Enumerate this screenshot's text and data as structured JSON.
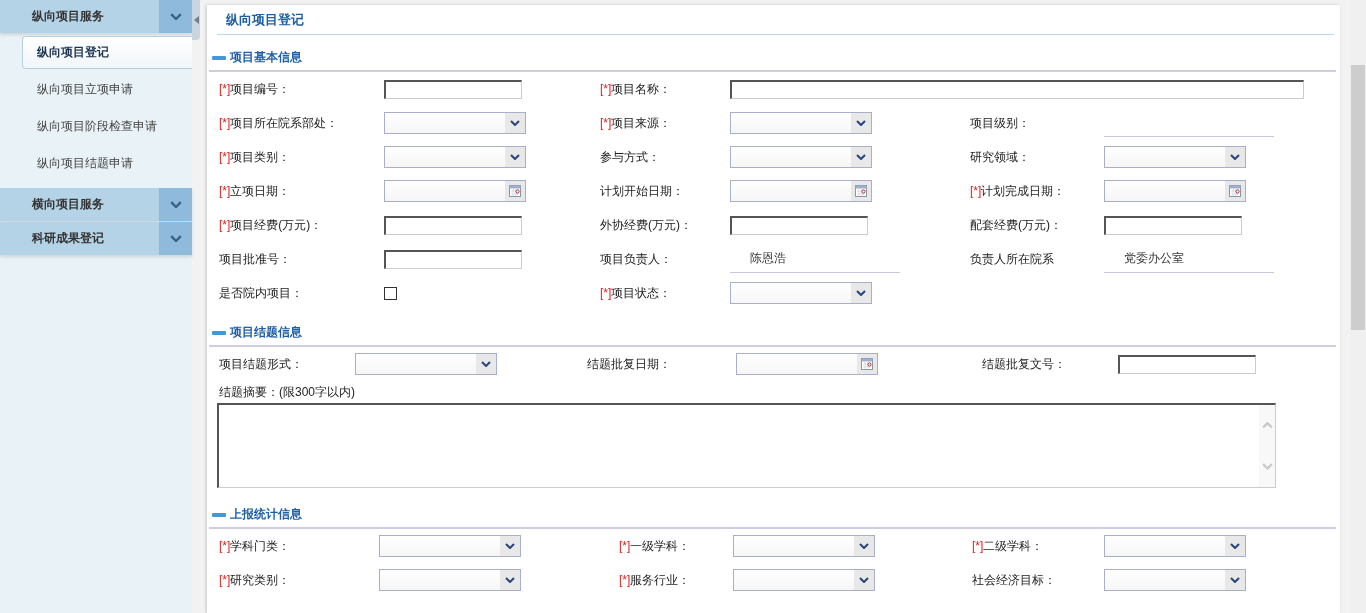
{
  "sidebar": {
    "groups": [
      {
        "label": "纵向项目服务",
        "items": [
          {
            "label": "纵向项目登记",
            "selected": true
          },
          {
            "label": "纵向项目立项申请",
            "selected": false
          },
          {
            "label": "纵向项目阶段检查申请",
            "selected": false
          },
          {
            "label": "纵向项目结题申请",
            "selected": false
          }
        ]
      },
      {
        "label": "横向项目服务"
      },
      {
        "label": "科研成果登记"
      }
    ]
  },
  "panel": {
    "title": "纵向项目登记"
  },
  "sections": [
    {
      "title": "项目基本信息",
      "rows": [
        [
          {
            "required_mark": "[*]",
            "label": "项目编号：",
            "kind": "text"
          },
          {
            "required_mark": "[*]",
            "label": "项目名称：",
            "kind": "wide_text"
          }
        ],
        [
          {
            "required_mark": "[*]",
            "label": "项目所在院系部处：",
            "kind": "select"
          },
          {
            "required_mark": "[*]",
            "label": "项目来源：",
            "kind": "select"
          },
          {
            "label": "项目级别：",
            "kind": "readonly"
          }
        ],
        [
          {
            "required_mark": "[*]",
            "label": "项目类别：",
            "kind": "select"
          },
          {
            "label": "参与方式：",
            "kind": "select"
          },
          {
            "label": "研究领域：",
            "kind": "select"
          }
        ],
        [
          {
            "required_mark": "[*]",
            "label": "立项日期：",
            "kind": "date"
          },
          {
            "label": "计划开始日期：",
            "kind": "date"
          },
          {
            "required_mark": "[*]",
            "label": "计划完成日期：",
            "kind": "date"
          }
        ],
        [
          {
            "required_mark": "[*]",
            "label": "项目经费(万元)：",
            "kind": "text"
          },
          {
            "label": "外协经费(万元)：",
            "kind": "text"
          },
          {
            "label": "配套经费(万元)：",
            "kind": "text"
          }
        ],
        [
          {
            "label": "项目批准号：",
            "kind": "text"
          },
          {
            "label": "项目负责人：",
            "kind": "readonly",
            "value": "陈恩浩"
          },
          {
            "label": "负责人所在院系",
            "kind": "readonly",
            "value": "党委办公室"
          }
        ],
        [
          {
            "label": "是否院内项目：",
            "kind": "checkbox",
            "checked": false
          },
          {
            "required_mark": "[*]",
            "label": "项目状态：",
            "kind": "select"
          }
        ]
      ]
    },
    {
      "title": "项目结题信息",
      "rows": [
        [
          {
            "label": "项目结题形式：",
            "kind": "select"
          },
          {
            "label": "结题批复日期：",
            "kind": "date"
          },
          {
            "label": "结题批复文号：",
            "kind": "text"
          }
        ],
        [
          {
            "label": "结题摘要：(限300字以内)",
            "kind": "note"
          }
        ],
        [
          {
            "kind": "textarea"
          }
        ]
      ]
    },
    {
      "title": "上报统计信息",
      "rows": [
        [
          {
            "required_mark": "[*]",
            "label": "学科门类：",
            "kind": "select"
          },
          {
            "required_mark": "[*]",
            "label": "一级学科：",
            "kind": "select"
          },
          {
            "required_mark": "[*]",
            "label": "二级学科：",
            "kind": "select"
          }
        ],
        [
          {
            "required_mark": "[*]",
            "label": "研究类别：",
            "kind": "select"
          },
          {
            "required_mark": "[*]",
            "label": "服务行业：",
            "kind": "select"
          },
          {
            "label": "社会经济目标：",
            "kind": "select"
          }
        ]
      ]
    }
  ]
}
